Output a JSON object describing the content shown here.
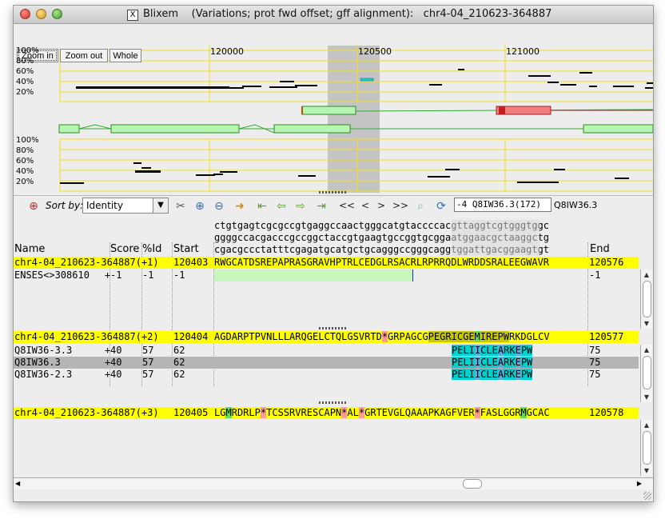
{
  "window": {
    "app": "Blixem",
    "title": "Blixem    (Variations; prot fwd offset; gff alignment):   chr4-04_210623-364887",
    "x_badge": "X"
  },
  "overview": {
    "zoom_in": "Zoom in",
    "zoom_out": "Zoom out",
    "whole": "Whole",
    "coords": [
      "120000",
      "120500",
      "121000"
    ],
    "pct_labels": [
      "100%",
      "80%",
      "60%",
      "40%",
      "20%"
    ]
  },
  "toolbar": {
    "sort_label": "Sort by:",
    "sort_value": "Identity",
    "nav": [
      "<<",
      "<",
      ">",
      ">>"
    ],
    "search_value": "-4   Q8IW36.3(172)",
    "current_match": "Q8IW36.3",
    "icons": [
      "lifebuoy-icon",
      "settings-icon",
      "zoom-in-icon",
      "zoom-out-icon",
      "goto-icon",
      "prev-match-icon",
      "back-icon",
      "forward-icon",
      "next-match-icon",
      "search-icon",
      "refresh-icon"
    ]
  },
  "headers": {
    "name": "Name",
    "score": "Score",
    "pid": "%Id",
    "start": "Start",
    "end": "End"
  },
  "dna": {
    "line1": "ctgtgagtcgcgccgtgaggccaactgggcatgtaccccacgttaggtcgtgggtggc",
    "line2": "ggggccacgacccgccggctaccgtgaagtgccggtgcggaatggaacgctaaggctg",
    "line3": "cgacgccctatttcgagatgcatgctgcagggccgggcaggtggattgacggaagtgt"
  },
  "frame1": {
    "ref": {
      "name": "chr4-04_210623-364887(+1)",
      "start": "120403",
      "seq": "RWGCATDSREPAPRASGRAVHPTRLCEDGLRSACRLRPRRQDLWRDDSRALEEGWAVR",
      "end": "120576"
    },
    "rows": [
      {
        "name": "ENSES<>308610",
        "strand": "+",
        "score": "-1",
        "pid": "-1",
        "start": "-1",
        "end": "-1"
      }
    ]
  },
  "frame2": {
    "ref": {
      "name": "chr4-04_210623-364887(+2)",
      "start": "120404",
      "seq": "AGDARPTPVNLLLARQGELCTQLGSVRTD*GRPAGCGPEGRICGEMIREPWRKDGLCV",
      "end": "120577"
    },
    "rows": [
      {
        "name": "Q8IW36-3.3",
        "strand": "+",
        "score": "40",
        "pid": "57",
        "start": "62",
        "seq": "PELIICLEARKEPW",
        "end": "75"
      },
      {
        "name": "Q8IW36.3",
        "strand": "+",
        "score": "40",
        "pid": "57",
        "start": "62",
        "seq": "PELIICLEARKEPW",
        "end": "75"
      },
      {
        "name": "Q8IW36-2.3",
        "strand": "+",
        "score": "40",
        "pid": "57",
        "start": "62",
        "seq": "PELIICLEARKEPW",
        "end": "75"
      }
    ]
  },
  "frame3": {
    "ref": {
      "name": "chr4-04_210623-364887(+3)",
      "start": "120405",
      "seq": "LGMRDRLP*TCSSRVRESCAPN*AL*GRTEVGLQAAAPKAGFVER*FASLGGRMGCAC",
      "end": "120578"
    }
  },
  "colors": {
    "ref_highlight": "#ffff00",
    "selected_row": "#b5b5b5",
    "identical": "#00d0d0",
    "conserved": "#59b0dc",
    "stop": "#ff9a9a",
    "met": "#66dd55",
    "exon_green": "#b8f5b0",
    "exon_red": "#f08080",
    "highlight_region": "#c4c4c4",
    "gridline": "#f0e020"
  }
}
